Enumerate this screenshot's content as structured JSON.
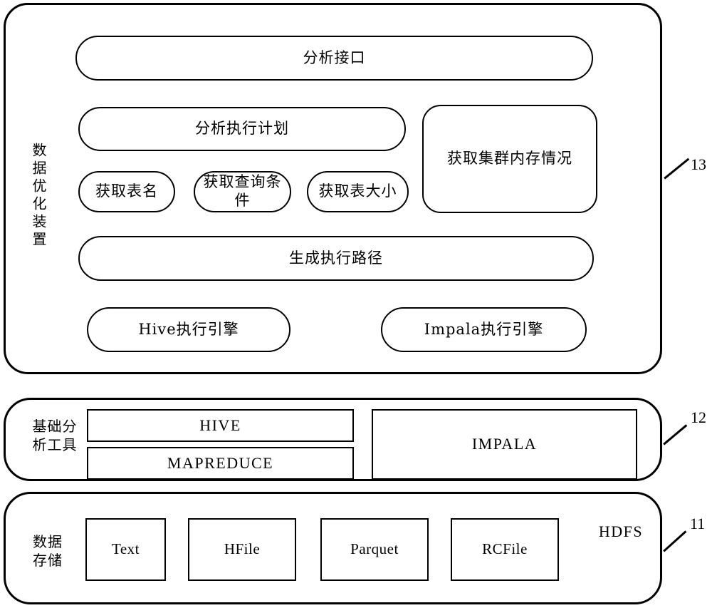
{
  "figure": {
    "type": "patent-architecture-diagram",
    "background_color": "#ffffff",
    "line_color": "#000000"
  },
  "layer_optimizer": {
    "ref": "13",
    "side_label": "数据优化装置",
    "analysis_interface": "分析接口",
    "analysis_plan": "分析执行计划",
    "cluster_memory": "获取集群内存情况",
    "get_table_name": "获取表名",
    "get_query_condition": "获取查询条\n件",
    "get_query_condition_line1": "获取查询条",
    "get_query_condition_line2": "件",
    "get_table_size": "获取表大小",
    "generate_path": "生成执行路径",
    "hive_engine": "Hive执行引擎",
    "impala_engine": "Impala执行引擎"
  },
  "layer_tools": {
    "ref": "12",
    "side_label_line1": "基础分",
    "side_label_line2": "析工具",
    "hive": "HIVE",
    "mapreduce": "MAPREDUCE",
    "impala": "IMPALA"
  },
  "layer_storage": {
    "ref": "11",
    "side_label_line1": "数据",
    "side_label_line2": "存储",
    "hdfs": "HDFS",
    "formats": [
      "Text",
      "HFile",
      "Parquet",
      "RCFile"
    ]
  }
}
